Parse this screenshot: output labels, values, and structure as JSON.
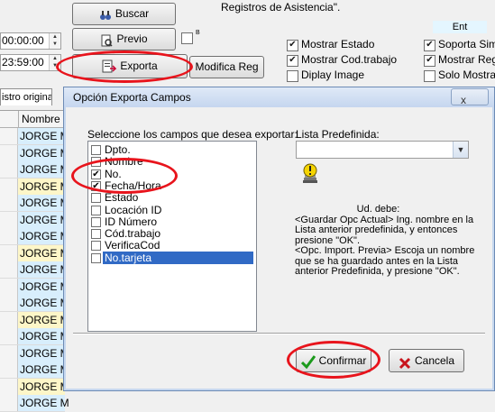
{
  "times": {
    "start": "00:00:00",
    "end": "23:59:00"
  },
  "buttons": {
    "buscar": "Buscar",
    "previo": "Previo",
    "exporta": "Exporta",
    "modifica": "Modifica Reg"
  },
  "header_text": "Registros de Asistencia\".",
  "small_tag": "Ent",
  "checkbox_b_label": "B",
  "options_left": [
    {
      "label": "Mostrar Estado",
      "checked": true
    },
    {
      "label": "Mostrar Cod.trabajo",
      "checked": true
    },
    {
      "label": "Diplay Image",
      "checked": false
    }
  ],
  "options_right": [
    {
      "label": "Soporta Simp",
      "checked": true
    },
    {
      "label": "Mostrar Reg.",
      "checked": true
    },
    {
      "label": "Solo Mostrar I",
      "checked": false
    }
  ],
  "tab_label": "istro original",
  "grid": {
    "header": "Nombre",
    "rows": [
      "JORGE M",
      "JORGE M",
      "JORGE M",
      "JORGE M",
      "JORGE M",
      "JORGE M",
      "JORGE M",
      "JORGE M",
      "JORGE M",
      "JORGE M",
      "JORGE M",
      "JORGE M",
      "JORGE M",
      "JORGE M",
      "JORGE M",
      "JORGE M",
      "JORGE M"
    ]
  },
  "dialog": {
    "title": "Opción Exporta Campos",
    "close_symbol": "x",
    "fields_prompt": "Seleccione los campos que desea exportar:",
    "fields": [
      {
        "label": "Dpto.",
        "checked": false
      },
      {
        "label": "Nombre",
        "checked": false
      },
      {
        "label": "No.",
        "checked": true
      },
      {
        "label": "Fecha/Hora",
        "checked": true
      },
      {
        "label": "Estado",
        "checked": false
      },
      {
        "label": "Locación ID",
        "checked": false
      },
      {
        "label": "ID Número",
        "checked": false
      },
      {
        "label": "Cód.trabajo",
        "checked": false
      },
      {
        "label": "VerificaCod",
        "checked": false
      },
      {
        "label": "No.tarjeta",
        "checked": false,
        "selected": true
      }
    ],
    "predefined_label": "Lista Predefinida:",
    "predefined_value": "",
    "info_title": "Ud. debe:",
    "info_lines": [
      "<Guardar Opc Actual> Ing. nombre en la Lista anterior predefinida, y entonces presione \"OK\".",
      "<Opc. Import. Previa> Escoja un nombre que se ha guardado antes en la Lista anterior Predefinida, y presione \"OK\"."
    ],
    "confirm_label": "Confirmar",
    "cancel_label": "Cancela"
  },
  "colors": {
    "highlight": "#e8141c",
    "selection": "#316ac5",
    "row_blue": "#d8eefc",
    "row_yellow": "#fdf6c8"
  }
}
